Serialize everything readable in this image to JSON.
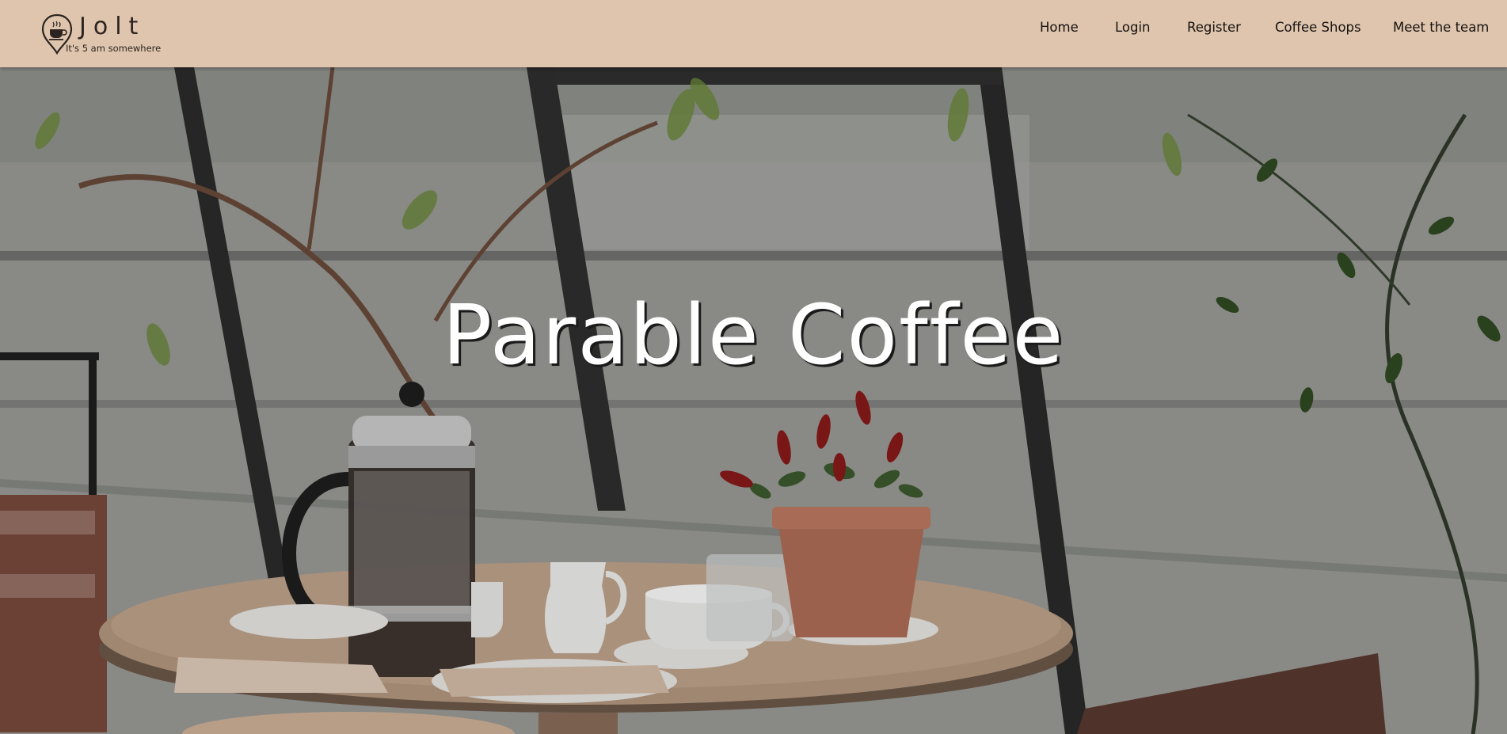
{
  "brand": {
    "name": "Jolt",
    "tagline": "It's 5 am somewhere",
    "icon": "coffee-location-pin-icon"
  },
  "nav": {
    "items": [
      {
        "label": "Home"
      },
      {
        "label": "Login"
      },
      {
        "label": "Register"
      },
      {
        "label": "Coffee Shops"
      },
      {
        "label": "Meet the team"
      }
    ]
  },
  "hero": {
    "title": "Parable Coffee",
    "background": "coffee-shop-table-photo"
  },
  "colors": {
    "navbar": "#dfc5ad",
    "nav_text": "#161210",
    "hero_title": "#ffffff"
  }
}
